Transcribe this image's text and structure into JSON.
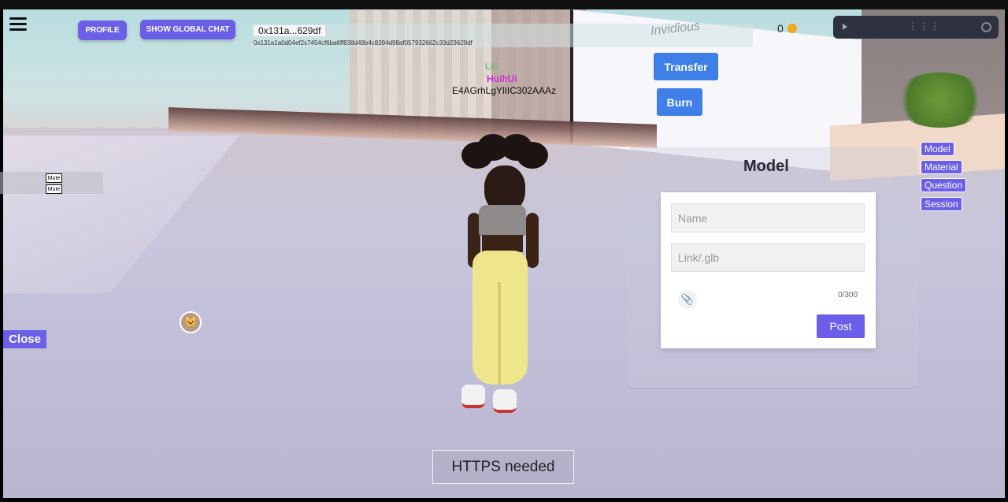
{
  "toolbar": {
    "profile_label": "PROFILE",
    "global_chat_label": "SHOW GLOBAL CHAT"
  },
  "wallet": {
    "address_short": "0x131a...629df",
    "address_full": "0x131a1a0d04ef2c7454cf6ba6ff838d49b4c8394d98af057932662c33d23629df",
    "coin_balance": "0",
    "transfer_label": "Transfer",
    "burn_label": "Burn"
  },
  "player_names": {
    "name_green": "Lili",
    "name_pink": "HuihUi",
    "id": "E4AGrhLgYlIIC302AAAz"
  },
  "screen": {
    "title": "Invidious"
  },
  "left_panel": {
    "mute_1": "Mute",
    "mute_2": "Mute",
    "close_label": "Close"
  },
  "model_panel": {
    "title": "Model",
    "name_placeholder": "Name",
    "link_placeholder": "Link/.glb",
    "counter": "0/300",
    "post_label": "Post"
  },
  "side_tabs": {
    "model": "Model",
    "material": "Material",
    "question": "Question",
    "session": "Session"
  },
  "notice": {
    "https": "HTTPS needed"
  },
  "colors": {
    "accent": "#6b5fe8",
    "action_blue": "#3f7fe8"
  }
}
